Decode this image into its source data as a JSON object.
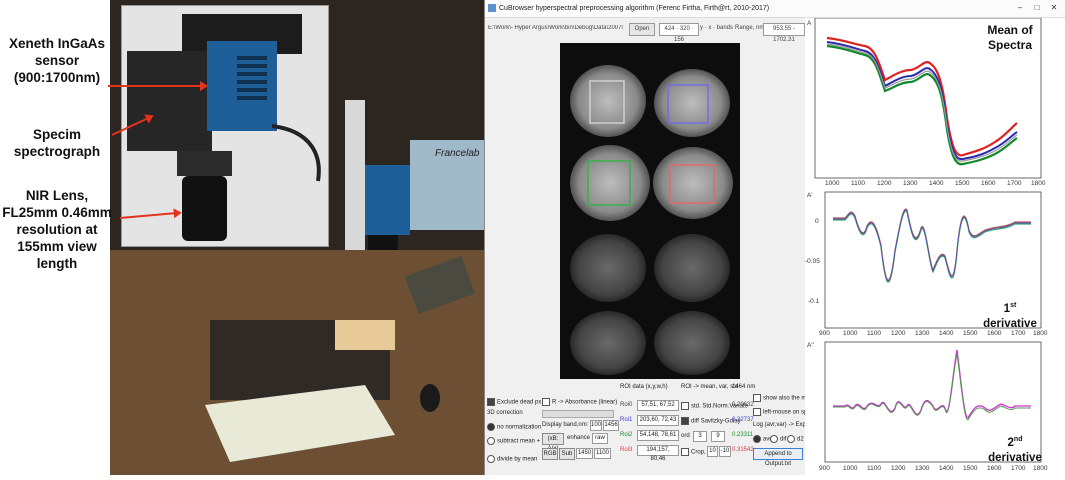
{
  "photo": {
    "labels": [
      {
        "id": "sensor",
        "lines": [
          "Xeneth InGaAs",
          "sensor",
          "(900:1700nm)"
        ]
      },
      {
        "id": "spectrograph",
        "lines": [
          "Specim",
          "spectrograph"
        ]
      },
      {
        "id": "lens",
        "lines": [
          "NIR Lens,",
          "FL25mm 0.46mm",
          "resolution at",
          "155mm view",
          "length"
        ]
      }
    ],
    "sign": "Francelab"
  },
  "app": {
    "title": "CuBrowser hyperspectral preprocessing algorithm (Ferenc Firtha, Firth@rt, 2010-2017)",
    "window_buttons": [
      "–",
      "□",
      "✕"
    ],
    "toolbar": {
      "path": "E:\\Work\\- Hyper Argus\\Work\\bin\\Debug\\Data\\200701 Date - ayman c",
      "open_label": "Open",
      "bands_value": "424 · 320 · 156",
      "bands_label": "y · x · bands",
      "range_label": "Range, nm:",
      "range_value": "953.55 - 1702.31"
    },
    "controls": {
      "exclude_dead": "Exclude dead px",
      "r_absorbance": "R -> Absorbance (linear)",
      "threed_correction": "3D correction",
      "no_norm": "no normalization",
      "subtract_mean": "subtract mean + 5",
      "divide_mean": "divide by mean",
      "display_band": "Display band,nm:",
      "display_band_val1": "100",
      "display_band_val2": "1456",
      "rxb_btn": "(xB: A(x)",
      "enhance": "enhance",
      "raw": "raw",
      "rgb": "RGB",
      "sub": "Sub",
      "val_1450": "1450",
      "val_1100": "1100",
      "roi_header": "ROI data (x,y,w,h)",
      "roi_rows": [
        {
          "name": "Roi0",
          "value": "57,51, 67,52"
        },
        {
          "name": "Roi1",
          "value": "203,60, 72,43"
        },
        {
          "name": "Roi2",
          "value": "54,148, 78,61"
        },
        {
          "name": "Roi3",
          "value": "194,157, 80,46"
        }
      ],
      "roi_mean_header": "ROI -> mean, var, std",
      "std_norm": "std. Std.Norm.Variate",
      "diff_sg": "diff Savitzky-Golay",
      "ord_label": "ord",
      "ord_value": "3",
      "win_value": "9",
      "crop_label": "Crop, b",
      "crop_v1": "10",
      "crop_v2": "-10",
      "col_1464_header": "1464",
      "col_1464_unit": "nm",
      "col_values": [
        "0.29632",
        "0.32737",
        "0.23311",
        "0.31542"
      ],
      "show_also": "show also the max/min",
      "left_mouse": "left-mouse on spectra",
      "log_export": "Log (avr,var) -> Export txt",
      "radio_avr": "avr",
      "radio_dif": "dif",
      "radio_d2": "d2",
      "append_btn": "Append to Output.txt"
    },
    "plots": [
      {
        "id": "mean",
        "title_lines": [
          "Mean of",
          "Spectra"
        ],
        "ylabel": "A",
        "yticks": [],
        "xticks": [
          "1000",
          "1100",
          "1200",
          "1300",
          "1400",
          "1500",
          "1600",
          "1700",
          "1800"
        ]
      },
      {
        "id": "d1",
        "title_lines": [
          "1",
          "derivative"
        ],
        "sup": "st",
        "ylabel": "A'",
        "yticks": [
          "0",
          "-0.05",
          "-0.1"
        ],
        "xticks": [
          "900",
          "1000",
          "1100",
          "1200",
          "1300",
          "1400",
          "1500",
          "1600",
          "1700",
          "1800"
        ]
      },
      {
        "id": "d2",
        "title_lines": [
          "2",
          "derivative"
        ],
        "sup": "nd",
        "ylabel": "A''",
        "yticks": [],
        "xticks": [
          "900",
          "1000",
          "1100",
          "1200",
          "1300",
          "1400",
          "1500",
          "1600",
          "1700",
          "1800"
        ]
      }
    ]
  },
  "colors": {
    "roi0": "#cfcfcf",
    "roi1": "#6f6fe6",
    "roi2": "#36b24a",
    "roi3": "#e36a6a",
    "arrow": "#e3331b",
    "screen": "#1e5f99"
  }
}
